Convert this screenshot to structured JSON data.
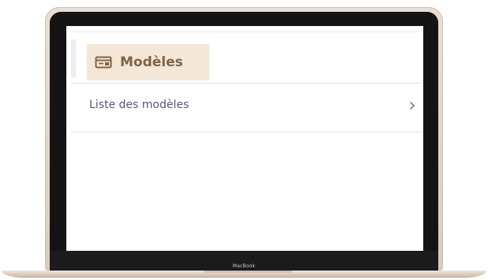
{
  "device": {
    "brand_label": "MacBook"
  },
  "header": {
    "title": "Modèles",
    "icon": "window-panel-icon"
  },
  "list": {
    "items": [
      {
        "label": "Liste des modèles",
        "icon": "chevron-right-icon"
      }
    ]
  },
  "colors": {
    "header_bg": "#f4e7d8",
    "header_text": "#7f6347",
    "list_text": "#555a78",
    "chevron": "#7d8096"
  }
}
